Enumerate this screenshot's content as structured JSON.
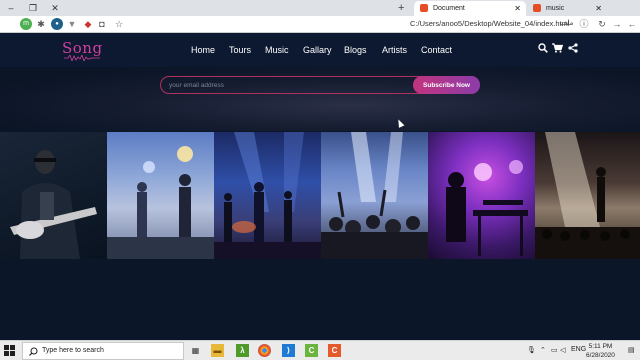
{
  "browser": {
    "tabs": [
      {
        "title": "Document",
        "active": true
      },
      {
        "title": "music",
        "active": false
      }
    ],
    "new_tab_label": "+",
    "url": "C:/Users/anoo5/Desktop/Website_04/index.html",
    "url_rtl_label": "ملف",
    "window_controls": {
      "minimize": "–",
      "restore": "❐",
      "close": "✕"
    }
  },
  "site": {
    "logo": "Song",
    "nav": [
      "Home",
      "Tours",
      "Music",
      "Gallary",
      "Blogs",
      "Artists",
      "Contact"
    ],
    "nav_icons": [
      "search-icon",
      "cart-icon",
      "share-icon"
    ],
    "subscribe": {
      "placeholder": "your email address",
      "button": "Subscribe Now"
    },
    "gallery": [
      "guitarist-with-sunglasses",
      "band-on-foggy-stage",
      "drummer-and-guitarist-blue-lights",
      "crowd-with-raised-hands",
      "keyboardist-purple-lights",
      "singer-spotlight-crowd"
    ],
    "accent_colors": {
      "brand": "#d23fa0",
      "button_start": "#c3347e",
      "button_end": "#8c3ca9",
      "background": "#0b1628"
    }
  },
  "taskbar": {
    "search_placeholder": "Type here to search",
    "language": "ENG",
    "time": "5:11 PM",
    "date": "6/28/2020"
  }
}
